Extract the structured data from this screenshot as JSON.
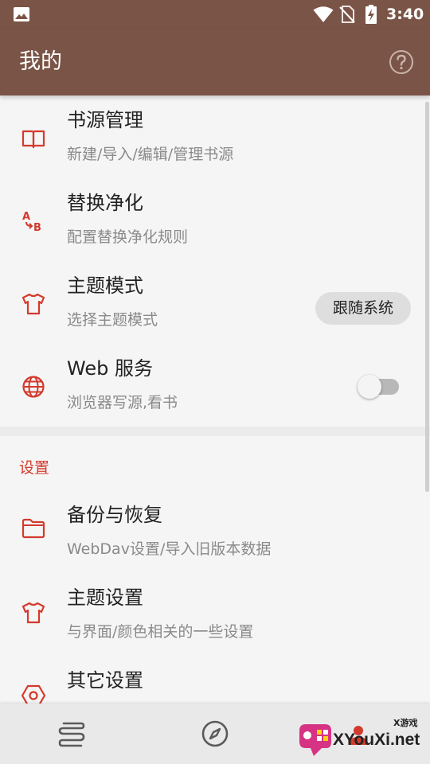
{
  "status_bar": {
    "time": "3:40"
  },
  "app_bar": {
    "title": "我的"
  },
  "items": [
    {
      "title": "书源管理",
      "subtitle": "新建/导入/编辑/管理书源",
      "icon": "book-icon"
    },
    {
      "title": "替换净化",
      "subtitle": "配置替换净化规则",
      "icon": "replace-ab-icon"
    },
    {
      "title": "主题模式",
      "subtitle": "选择主题模式",
      "icon": "shirt-icon",
      "value": "跟随系统"
    },
    {
      "title": "Web 服务",
      "subtitle": "浏览器写源,看书",
      "icon": "globe-icon",
      "toggle": false
    }
  ],
  "section": {
    "label": "设置"
  },
  "settings_items": [
    {
      "title": "备份与恢复",
      "subtitle": "WebDav设置/导入旧版本数据",
      "icon": "folder-icon"
    },
    {
      "title": "主题设置",
      "subtitle": "与界面/颜色相关的一些设置",
      "icon": "shirt-icon"
    },
    {
      "title": "其它设置",
      "subtitle": "",
      "icon": "hexagon-settings-icon"
    }
  ],
  "bottom_nav": [
    {
      "icon": "bookshelf-icon"
    },
    {
      "icon": "compass-icon"
    },
    {
      "icon": "profile-icon"
    }
  ],
  "watermark": {
    "brand": "XYouXi.net",
    "small": "X游戏"
  },
  "colors": {
    "primary": "#7a5446",
    "accent": "#d33a2c",
    "background": "#f5f5f5"
  }
}
